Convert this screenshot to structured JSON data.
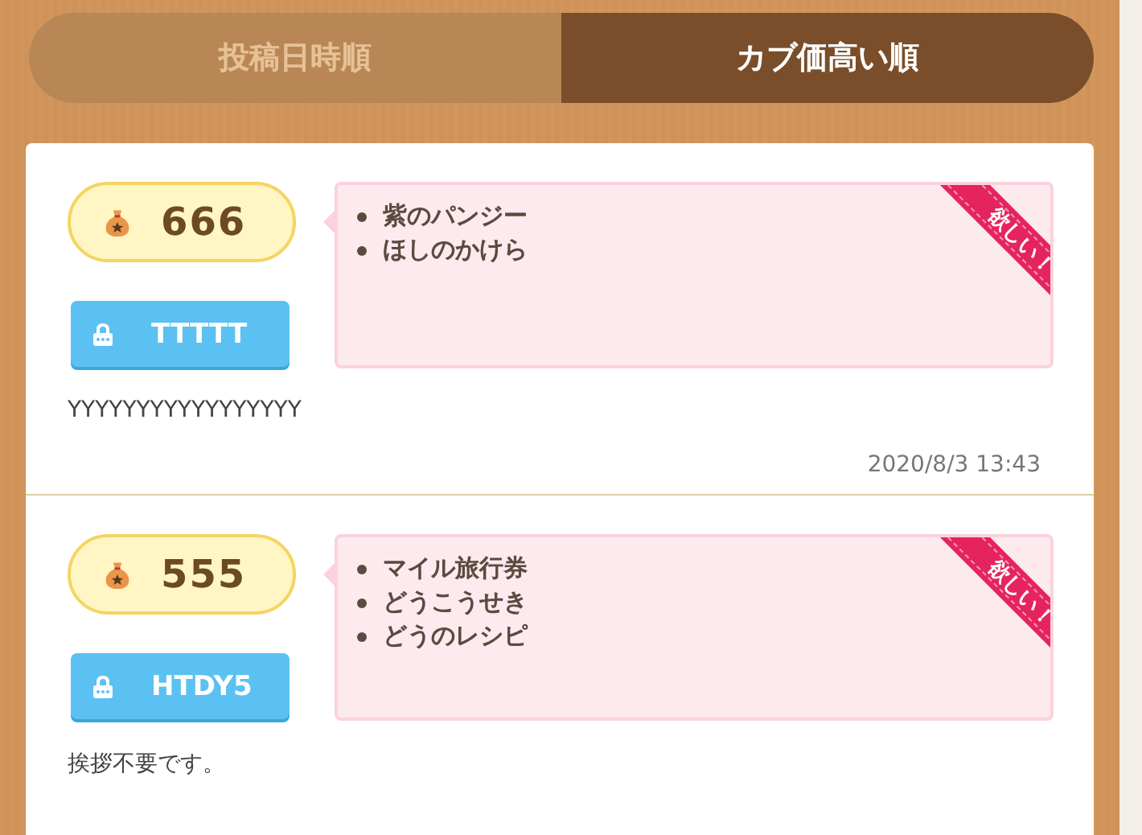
{
  "sort_tabs": [
    {
      "label": "投稿日時順",
      "selected": false
    },
    {
      "label": "カブ価高い順",
      "selected": true
    }
  ],
  "posts": [
    {
      "price": "666",
      "code": "TTTTT",
      "ribbon": "欲しい！",
      "wants": [
        "紫のパンジー",
        "ほしのかけら"
      ],
      "message": "YYYYYYYYYYYYYYYYY",
      "posted": "2020/8/3 13:43"
    },
    {
      "price": "555",
      "code": "HTDY5",
      "ribbon": "欲しい！",
      "wants": [
        "マイル旅行券",
        "どうこうせき",
        "どうのレシピ"
      ],
      "message": "挨拶不要です。"
    }
  ]
}
